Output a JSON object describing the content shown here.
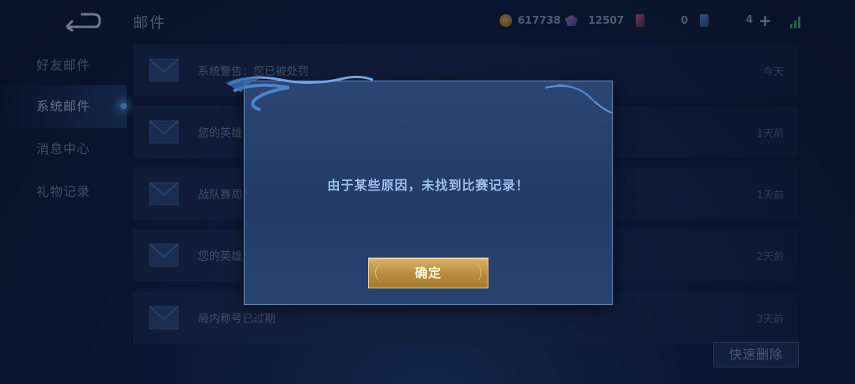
{
  "header": {
    "title": "邮件",
    "gold": "617738",
    "diamonds": "12507",
    "tickets": "0",
    "vouchers": "4"
  },
  "sidebar": {
    "items": [
      {
        "label": "好友邮件"
      },
      {
        "label": "系统邮件"
      },
      {
        "label": "消息中心"
      },
      {
        "label": "礼物记录"
      }
    ]
  },
  "mails": [
    {
      "title": "系统警告：您已被处罚",
      "time": "今天"
    },
    {
      "title": "您的英雄",
      "time": "1天前"
    },
    {
      "title": "战队赛周",
      "time": "1天前"
    },
    {
      "title": "您的英雄",
      "time": "2天前"
    },
    {
      "title": "局内称号已过期",
      "time": "3天前"
    }
  ],
  "quick_delete_label": "快速删除",
  "dialog": {
    "message": "由于某些原因，未找到比赛记录！",
    "confirm_label": "确定"
  },
  "colors": {
    "accent_gold": "#d9b366",
    "dialog_bg": "#2a4673",
    "message_text": "#9cc0ef",
    "signal_green": "#3ea85a"
  }
}
